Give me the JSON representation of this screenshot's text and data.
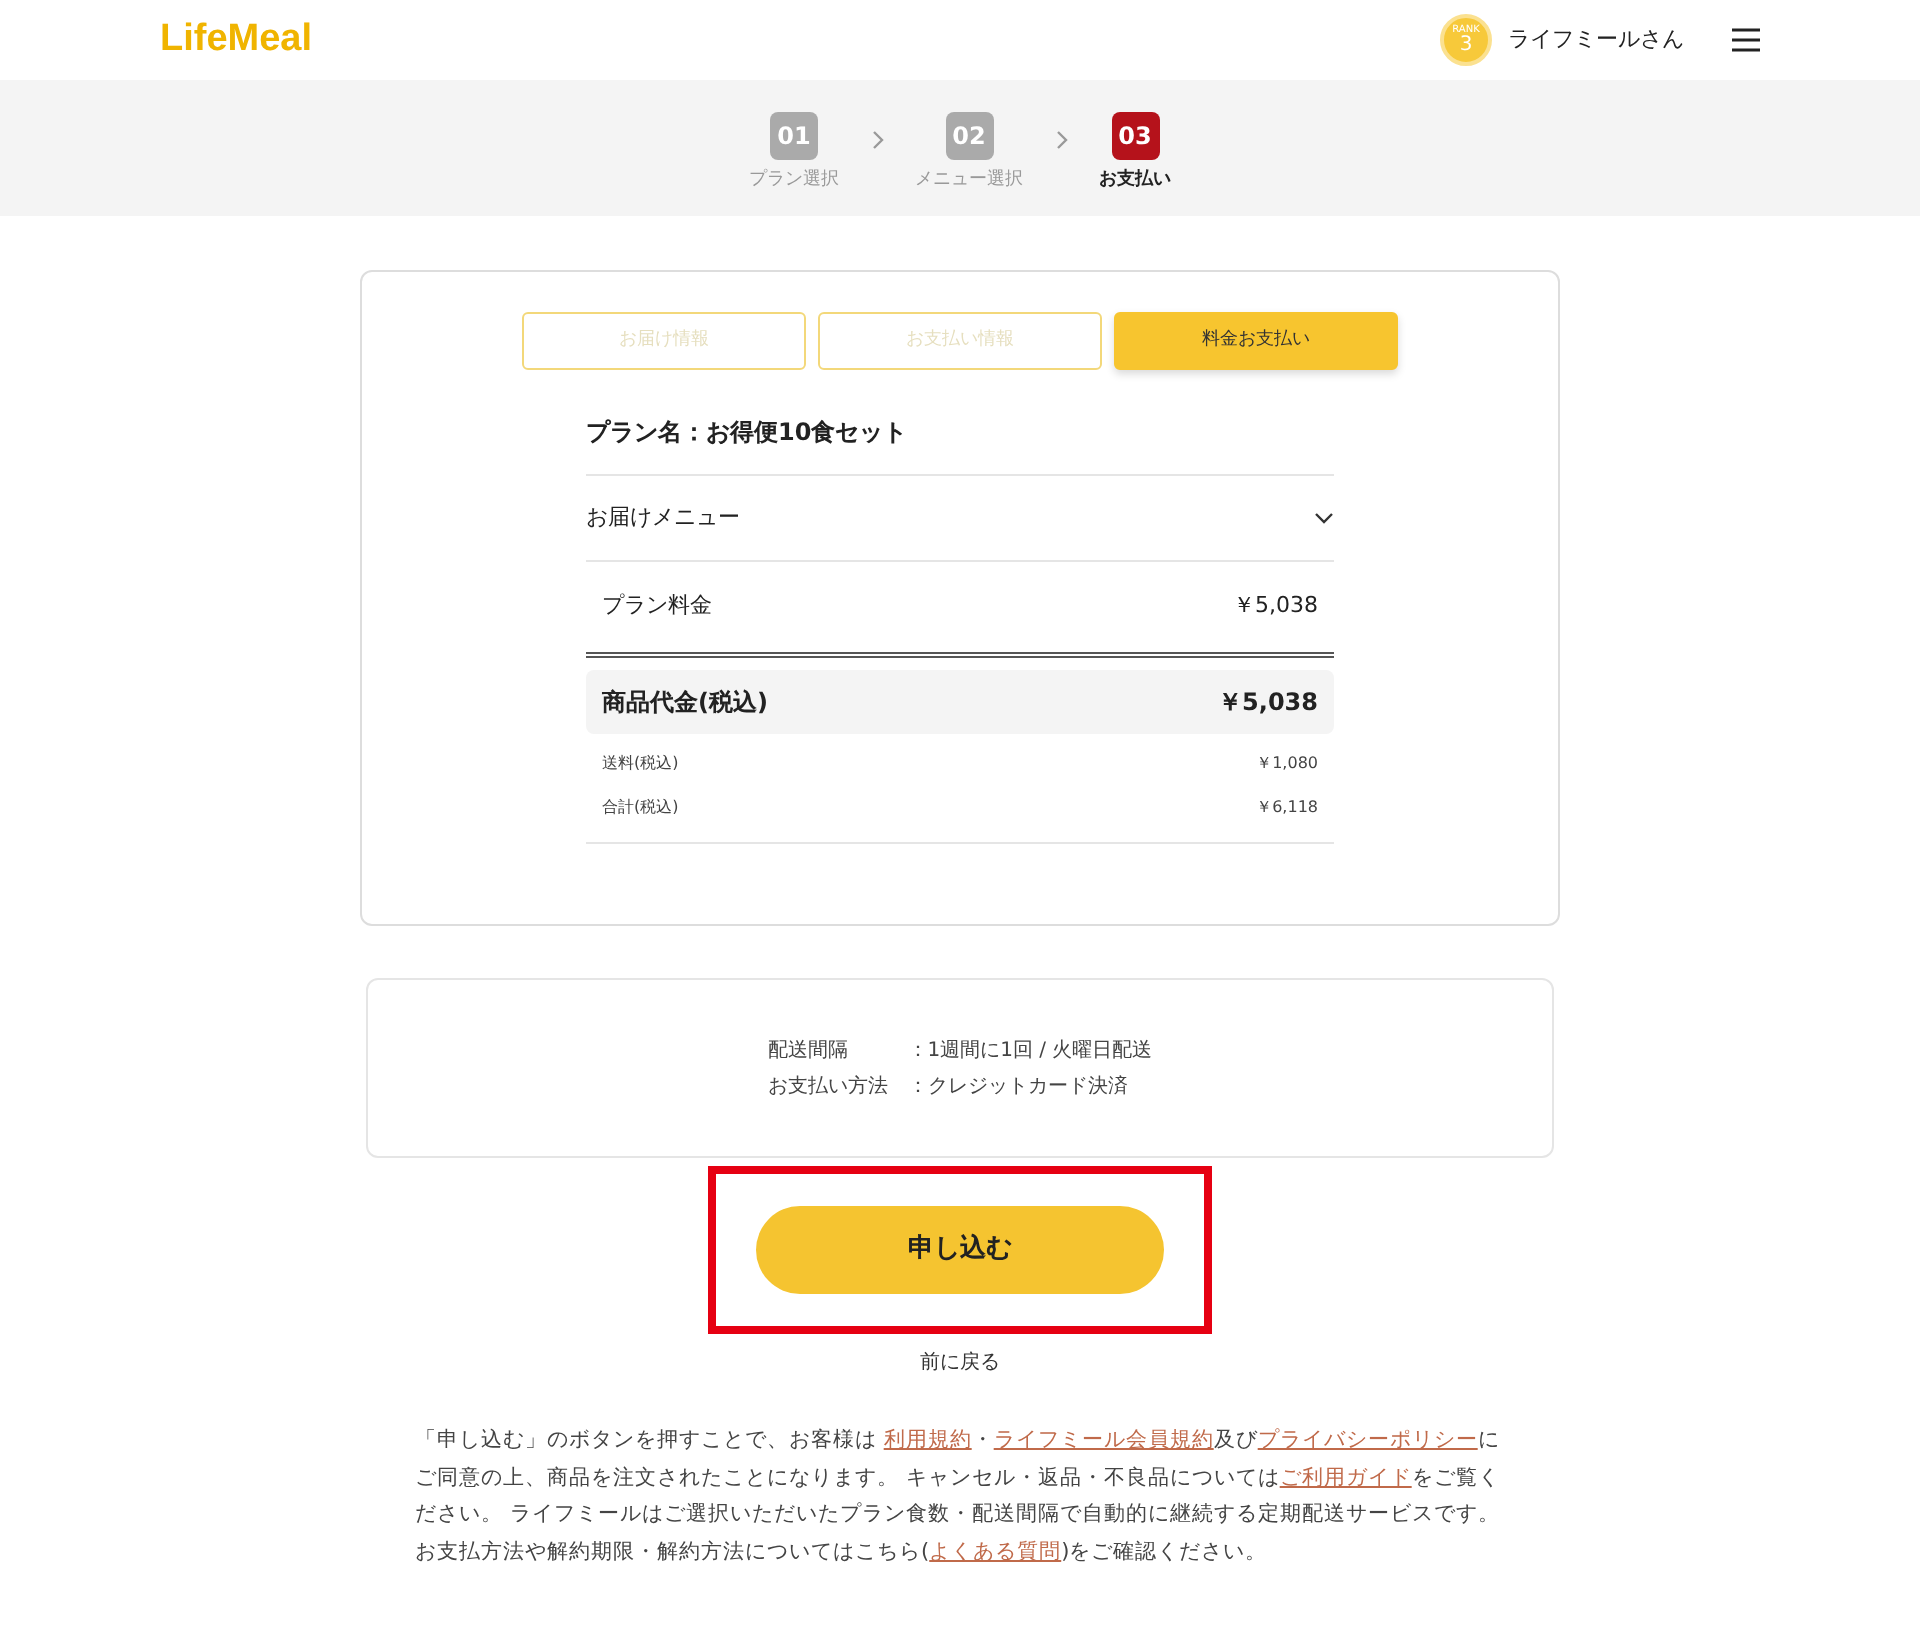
{
  "header": {
    "logo": "LifeMeal",
    "rank_badge": {
      "label": "RANK",
      "value": "3"
    },
    "user_name": "ライフミールさん"
  },
  "steps": [
    {
      "number": "01",
      "label": "プラン選択",
      "selected": false
    },
    {
      "number": "02",
      "label": "メニュー選択",
      "selected": false
    },
    {
      "number": "03",
      "label": "お支払い",
      "selected": true
    }
  ],
  "tabs": [
    {
      "label": "お届け情報",
      "selected": false
    },
    {
      "label": "お支払い情報",
      "selected": false
    },
    {
      "label": "料金お支払い",
      "selected": true
    }
  ],
  "plan_name": "プラン名：お得便10食セット",
  "menu_accordion": {
    "label": "お届けメニュー",
    "expanded": false
  },
  "plan_fee": {
    "label": "プラン料金",
    "value": "￥5,038"
  },
  "subtotal": {
    "label": "商品代金(税込)",
    "value": "￥5,038"
  },
  "fees": [
    {
      "label": "送料(税込)",
      "value": "￥1,080"
    },
    {
      "label": "合計(税込)",
      "value": "￥6,118"
    }
  ],
  "delivery_info": [
    {
      "label": "配送間隔",
      "value": "：1週間に1回 / 火曜日配送"
    },
    {
      "label": "お支払い方法",
      "value": "：クレジットカード決済"
    }
  ],
  "submit_button": {
    "label": "申し込む",
    "highlighted": true
  },
  "back_link": "前に戻る",
  "notice": [
    {
      "text": "「申し込む」のボタンを押すことで、お客様は ",
      "link": false
    },
    {
      "text": "利用規約",
      "link": true
    },
    {
      "text": "・",
      "link": false
    },
    {
      "text": "ライフミール会員規約",
      "link": true
    },
    {
      "text": "及び",
      "link": false
    },
    {
      "text": "プライバシーポリシー",
      "link": true
    },
    {
      "text": "にご同意の上、商品を注文されたことになります。 キャンセル・返品・不良品については",
      "link": false
    },
    {
      "text": "ご利用ガイド",
      "link": true
    },
    {
      "text": "をご覧ください。 ライフミールはご選択いただいたプラン食数・配送間隔で自動的に継続する定期配送サービスです。お支払方法や解約期限・解約方法についてはこちら(",
      "link": false
    },
    {
      "text": "よくある質問",
      "link": true
    },
    {
      "text": ")をご確認ください。",
      "link": false
    }
  ]
}
